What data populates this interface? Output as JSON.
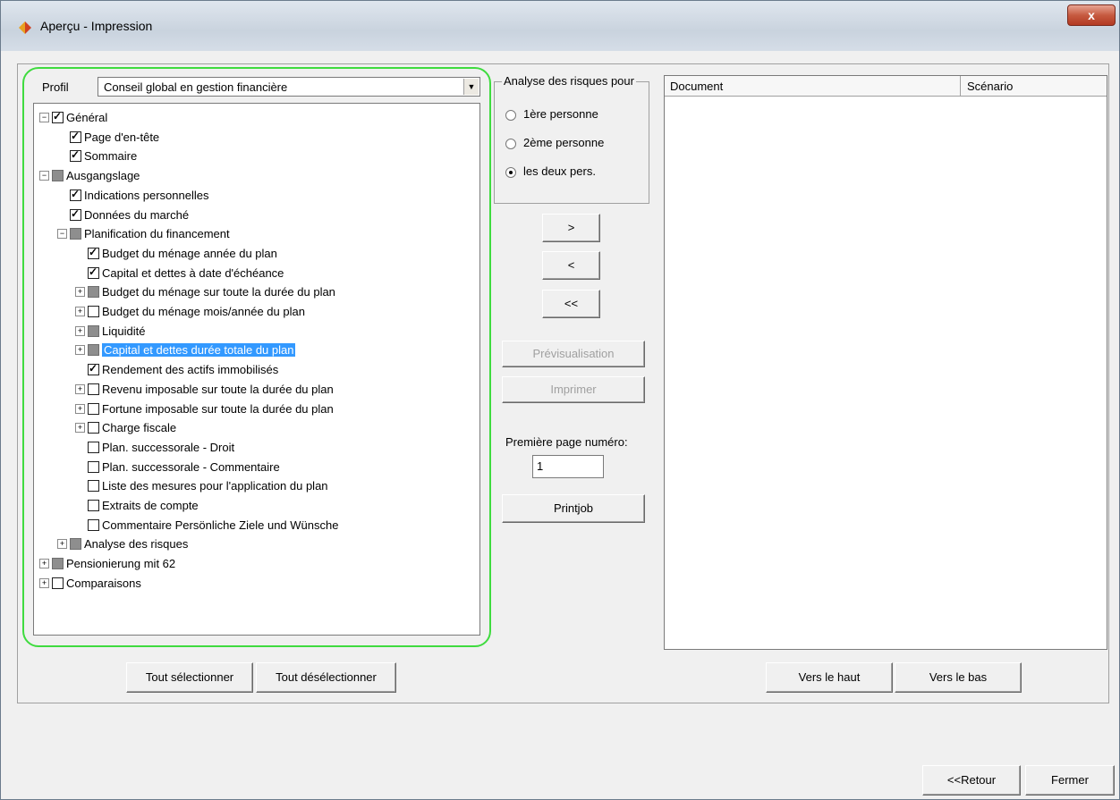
{
  "window": {
    "title": "Aperçu - Impression",
    "close_glyph": "x"
  },
  "profil": {
    "label": "Profil",
    "selected": "Conseil global en gestion financière"
  },
  "tree": [
    {
      "label": "Général",
      "level": 0,
      "expander": "minus",
      "state": "checked"
    },
    {
      "label": "Page d'en-tête",
      "level": 1,
      "expander": "none",
      "state": "checked"
    },
    {
      "label": "Sommaire",
      "level": 1,
      "expander": "none",
      "state": "checked"
    },
    {
      "label": "Ausgangslage",
      "level": 0,
      "expander": "minus",
      "state": "partial"
    },
    {
      "label": "Indications personnelles",
      "level": 1,
      "expander": "none",
      "state": "checked"
    },
    {
      "label": "Données du marché",
      "level": 1,
      "expander": "none",
      "state": "checked"
    },
    {
      "label": "Planification du financement",
      "level": 1,
      "expander": "minus",
      "state": "partial"
    },
    {
      "label": "Budget du ménage année du plan",
      "level": 2,
      "expander": "none",
      "state": "checked"
    },
    {
      "label": "Capital et dettes à date d'échéance",
      "level": 2,
      "expander": "none",
      "state": "checked"
    },
    {
      "label": "Budget du ménage sur toute la durée du plan",
      "level": 2,
      "expander": "plus",
      "state": "partial"
    },
    {
      "label": "Budget du ménage mois/année du plan",
      "level": 2,
      "expander": "plus",
      "state": "unchecked"
    },
    {
      "label": "Liquidité",
      "level": 2,
      "expander": "plus",
      "state": "partial"
    },
    {
      "label": "Capital et dettes durée totale du plan",
      "level": 2,
      "expander": "plus",
      "state": "partial",
      "selected": true
    },
    {
      "label": "Rendement des actifs immobilisés",
      "level": 2,
      "expander": "none",
      "state": "checked"
    },
    {
      "label": "Revenu imposable sur toute la durée du plan",
      "level": 2,
      "expander": "plus",
      "state": "unchecked"
    },
    {
      "label": "Fortune imposable sur toute la durée du plan",
      "level": 2,
      "expander": "plus",
      "state": "unchecked"
    },
    {
      "label": "Charge fiscale",
      "level": 2,
      "expander": "plus",
      "state": "unchecked"
    },
    {
      "label": "Plan. successorale - Droit",
      "level": 2,
      "expander": "none",
      "state": "unchecked"
    },
    {
      "label": "Plan. successorale - Commentaire",
      "level": 2,
      "expander": "none",
      "state": "unchecked"
    },
    {
      "label": "Liste des mesures pour l'application du plan",
      "level": 2,
      "expander": "none",
      "state": "unchecked"
    },
    {
      "label": "Extraits de compte",
      "level": 2,
      "expander": "none",
      "state": "unchecked"
    },
    {
      "label": "Commentaire Persönliche Ziele und Wünsche",
      "level": 2,
      "expander": "none",
      "state": "unchecked"
    },
    {
      "label": "Analyse des risques",
      "level": 1,
      "expander": "plus",
      "state": "partial"
    },
    {
      "label": "Pensionierung mit 62",
      "level": 0,
      "expander": "plus",
      "state": "partial"
    },
    {
      "label": "Comparaisons",
      "level": 0,
      "expander": "plus",
      "state": "unchecked"
    }
  ],
  "risk": {
    "title": "Analyse des risques pour",
    "options": [
      {
        "label": "1ère personne",
        "selected": false
      },
      {
        "label": "2ème personne",
        "selected": false
      },
      {
        "label": "les deux pers.",
        "selected": true
      }
    ]
  },
  "buttons": {
    "add": ">",
    "remove": "<",
    "remove_all": "<<",
    "preview": "Prévisualisation",
    "print": "Imprimer",
    "printjob": "Printjob",
    "select_all": "Tout sélectionner",
    "deselect_all": "Tout désélectionner",
    "move_up": "Vers le haut",
    "move_down": "Vers le bas",
    "back": "<<Retour",
    "close": "Fermer"
  },
  "first_page": {
    "label": "Première page numéro:",
    "value": "1"
  },
  "list": {
    "col_document": "Document",
    "col_scenario": "Scénario"
  },
  "colors": {
    "highlight_border": "#3fdb3f",
    "selection": "#3399ff"
  }
}
